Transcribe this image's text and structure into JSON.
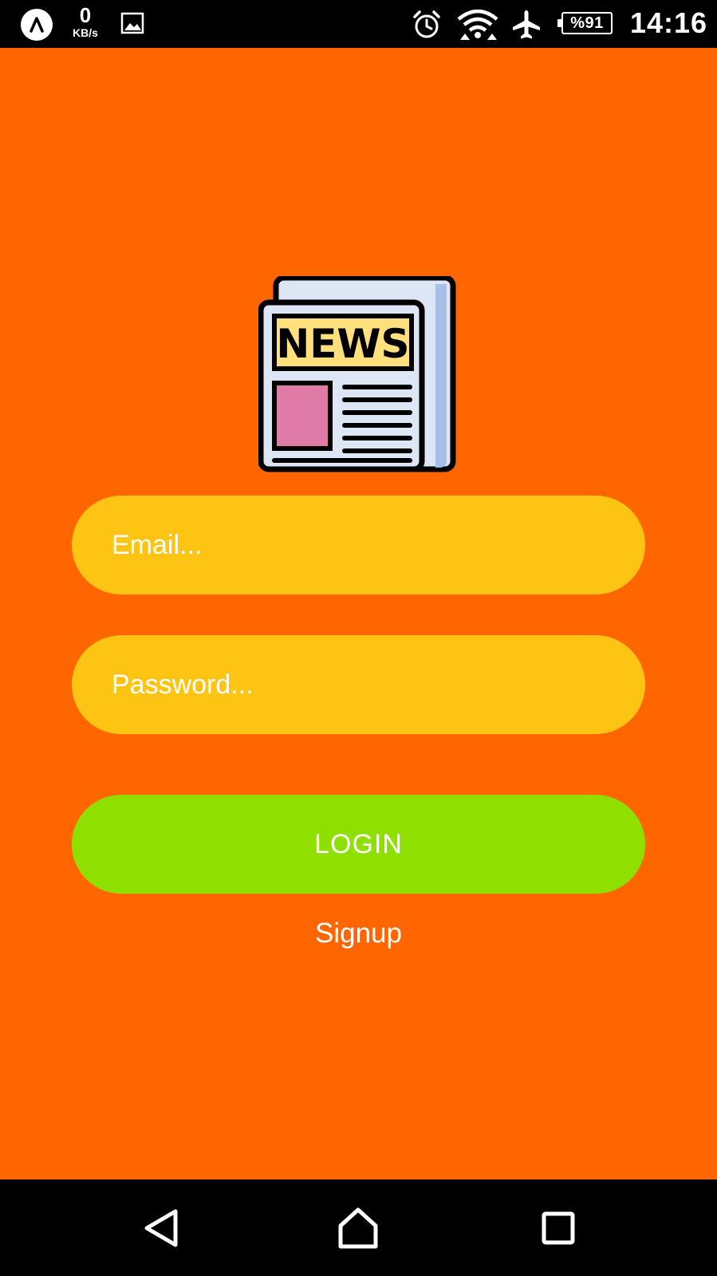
{
  "status_bar": {
    "net_speed_value": "0",
    "net_speed_unit": "KB/s",
    "battery": "%91",
    "time": "14:16",
    "icons": [
      "app-launcher-icon",
      "gallery-icon",
      "alarm-icon",
      "wifi-icon",
      "airplane-mode-icon",
      "battery-icon"
    ]
  },
  "logo": {
    "text": "NEWS",
    "icon": "newspaper-icon",
    "colors": {
      "header_fill": "#FFE07D",
      "photo_fill": "#E07AA6",
      "paper_fill": "#DCE6F5",
      "back_fill": "#A7BFE6"
    }
  },
  "form": {
    "email_placeholder": "Email...",
    "password_placeholder": "Password...",
    "login_label": "LOGIN",
    "signup_label": "Signup"
  },
  "nav_bar": {
    "buttons": [
      "back-icon",
      "home-icon",
      "recent-apps-icon"
    ]
  },
  "colors": {
    "background": "#FF6600",
    "input_fill": "#FDC414",
    "login_fill": "#8FE000",
    "text": "#FFFFFF",
    "system_bars": "#000000"
  }
}
